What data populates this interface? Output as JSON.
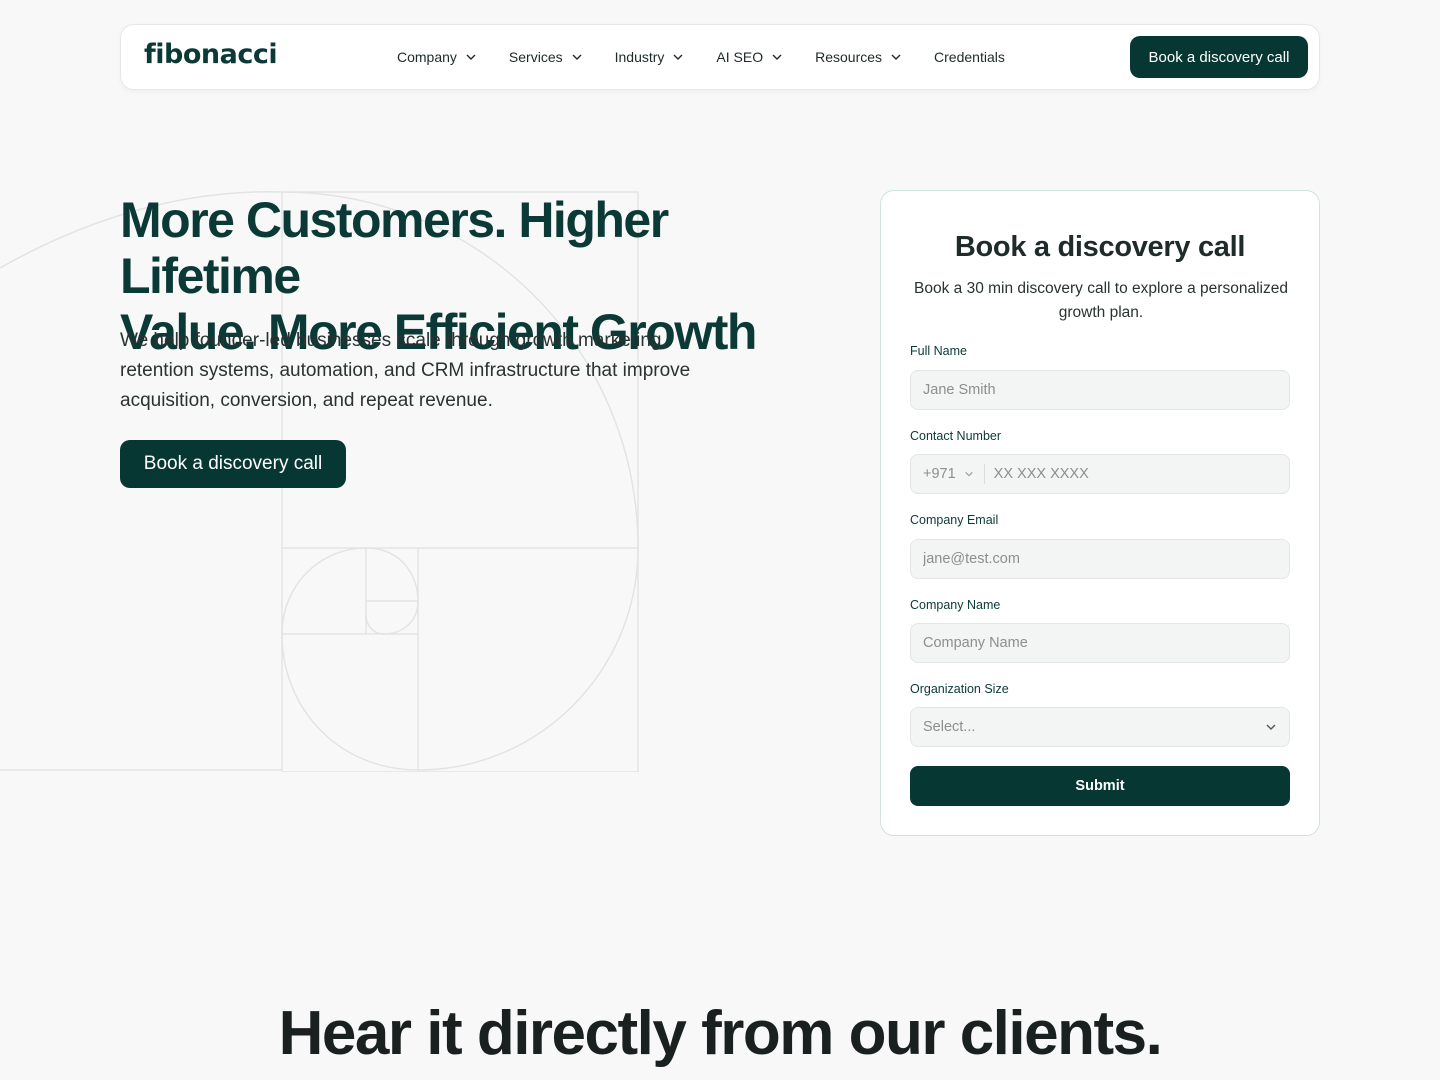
{
  "brand": {
    "logo_text": "fibonacci",
    "accent": "#063733"
  },
  "nav": {
    "items": [
      {
        "label": "Company",
        "has_dropdown": true
      },
      {
        "label": "Services",
        "has_dropdown": true
      },
      {
        "label": "Industry",
        "has_dropdown": true
      },
      {
        "label": "AI SEO",
        "has_dropdown": true
      },
      {
        "label": "Resources",
        "has_dropdown": true
      },
      {
        "label": "Credentials",
        "has_dropdown": false
      }
    ],
    "cta_label": "Book a discovery call"
  },
  "hero": {
    "title_line1": "More Customers. Higher Lifetime",
    "title_line2": "Value. More Efficient Growth",
    "description": "We help founder-led businesses scale through growth marketing, retention systems, automation, and CRM infrastructure that improve acquisition, conversion, and repeat revenue.",
    "cta_label": "Book a discovery call"
  },
  "form": {
    "title": "Book a discovery call",
    "subtitle": "Book a 30 min discovery call to explore a personalized growth plan.",
    "full_name": {
      "label": "Full Name",
      "placeholder": "Jane Smith",
      "value": ""
    },
    "contact": {
      "label": "Contact Number",
      "country_code": "+971",
      "placeholder": "XX XXX XXXX",
      "value": ""
    },
    "email": {
      "label": "Company Email",
      "placeholder": "jane@test.com",
      "value": ""
    },
    "company": {
      "label": "Company Name",
      "placeholder": "Company Name",
      "value": ""
    },
    "org_size": {
      "label": "Organization Size",
      "selected": "Select..."
    },
    "submit_label": "Submit"
  },
  "testimonials": {
    "heading": "Hear it directly from our clients."
  }
}
